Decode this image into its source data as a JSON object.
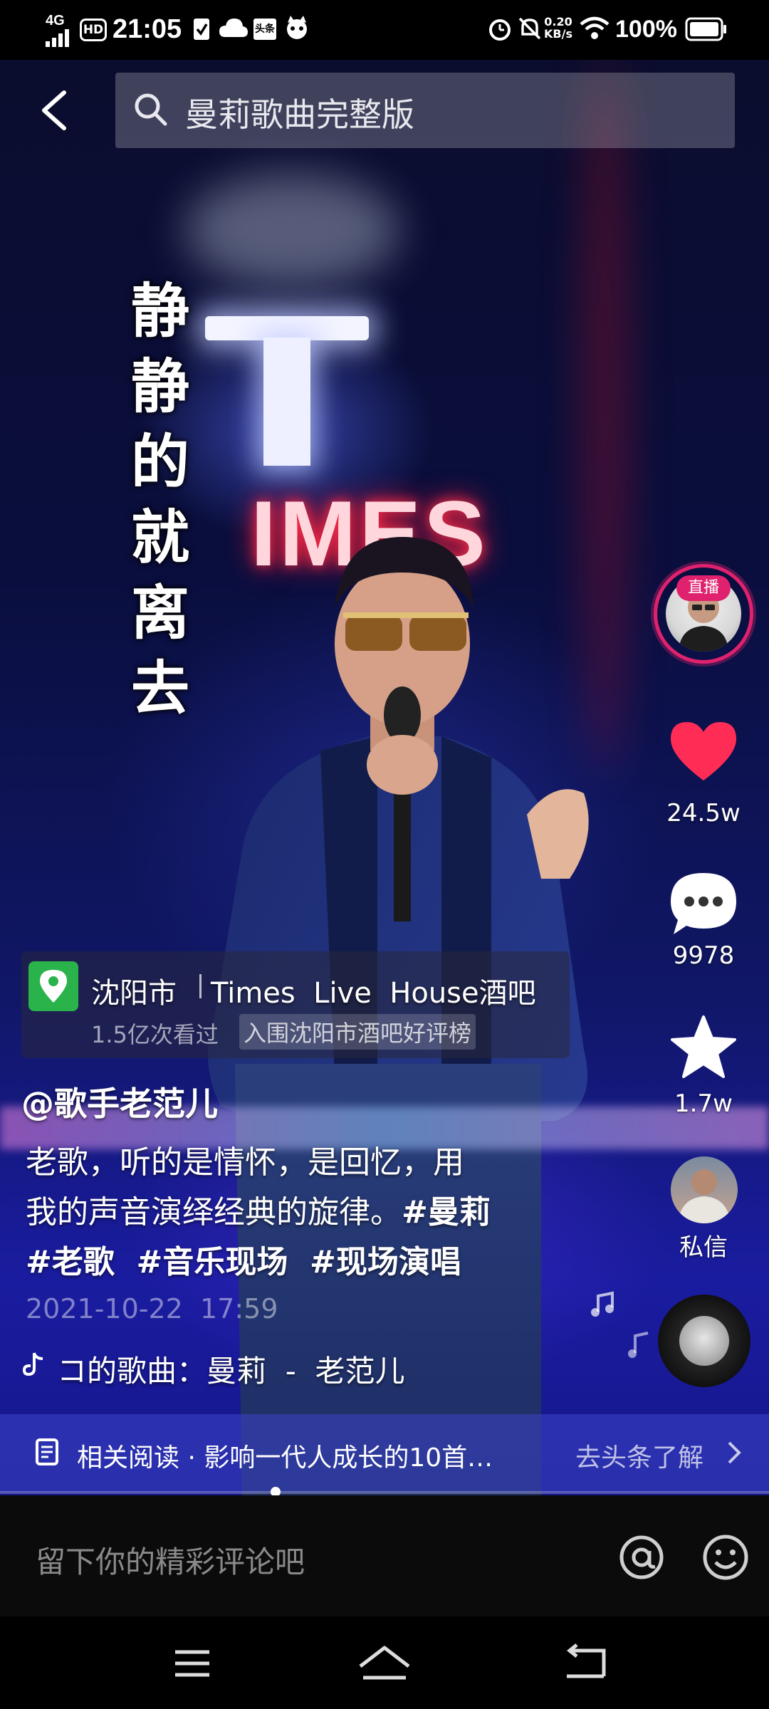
{
  "status_bar": {
    "network": "4G",
    "hd": "HD",
    "time": "21:05",
    "app_badge": "头条",
    "speed_value": "0.20",
    "speed_unit": "KB/s",
    "battery": "100%"
  },
  "search": {
    "query": "曼莉歌曲完整版"
  },
  "video": {
    "sign_text": "IMES",
    "lyric_chars": [
      "静",
      "静",
      "的",
      "就",
      "离",
      "去"
    ]
  },
  "side": {
    "live_badge": "直播",
    "likes": "24.5w",
    "comments": "9978",
    "favorites": "1.7w",
    "message_label": "私信"
  },
  "location": {
    "city": "沈阳市",
    "place": "Times  Live  House酒吧",
    "views": "1.5亿次看过",
    "ranking": "入围沈阳市酒吧好评榜"
  },
  "post": {
    "author": "@歌手老范儿",
    "caption_line1": "老歌，听的是情怀，是回忆，用",
    "caption_line2_text": "我的声音演绎经典的旋律。",
    "caption_line2_tag": "#曼莉",
    "tags": [
      "#老歌",
      "#音乐现场",
      "#现场演唱"
    ],
    "date": "2021-10-22  17:59",
    "music": "コ的歌曲：曼莉  -  老范儿"
  },
  "related": {
    "text": "相关阅读 · 影响一代人成长的10首…",
    "action": "去头条了解"
  },
  "comment_bar": {
    "placeholder": "留下你的精彩评论吧"
  },
  "colors": {
    "like": "#ff2d55",
    "live_ring": "#e0226e",
    "location_icon": "#2bb34b"
  }
}
